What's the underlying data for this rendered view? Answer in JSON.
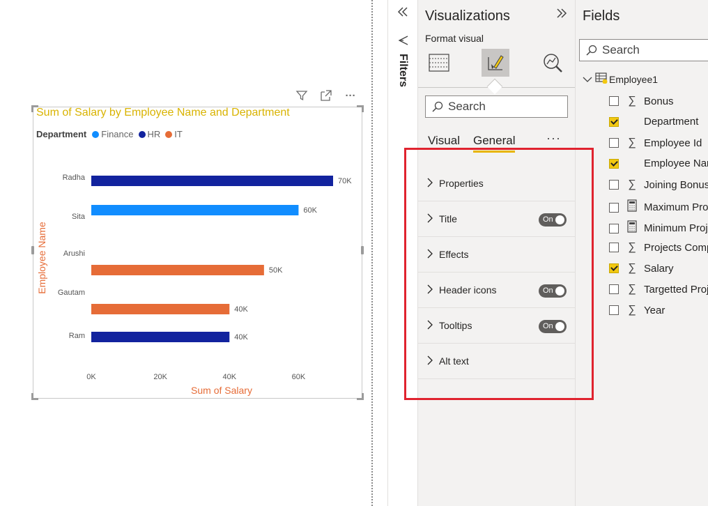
{
  "visual_header": {
    "filter_icon": "funnel-icon",
    "focus_icon": "focus-mode-icon",
    "more_icon": "more-options-icon",
    "more_label": "···"
  },
  "chart": {
    "title": "Sum of Salary by Employee Name and Department",
    "legend_title": "Department",
    "legend": [
      {
        "name": "Finance",
        "color": "#118dff"
      },
      {
        "name": "HR",
        "color": "#12239e"
      },
      {
        "name": "IT",
        "color": "#e66c37"
      }
    ]
  },
  "chart_data": {
    "type": "bar",
    "orientation": "horizontal",
    "title": "Sum of Salary by Employee Name and Department",
    "xlabel": "Sum of Salary",
    "ylabel": "Employee Name",
    "xlim": [
      0,
      70000
    ],
    "x_ticks": [
      "0K",
      "20K",
      "40K",
      "60K"
    ],
    "legend_title": "Department",
    "categories": [
      "Radha",
      "Sita",
      "Arushi",
      "Gautam",
      "Ram"
    ],
    "series": [
      {
        "name": "Finance",
        "color": "#118dff",
        "values": [
          null,
          60000,
          null,
          null,
          null
        ]
      },
      {
        "name": "HR",
        "color": "#12239e",
        "values": [
          70000,
          null,
          null,
          null,
          40000
        ]
      },
      {
        "name": "IT",
        "color": "#e66c37",
        "values": [
          null,
          null,
          50000,
          40000,
          null
        ]
      }
    ],
    "data_labels": [
      "70K",
      "60K",
      "50K",
      "40K",
      "40K"
    ],
    "grid": false,
    "legend_position": "top-left"
  },
  "filters": {
    "collapse_icon": "double-chevron-left-icon",
    "label": "Filters"
  },
  "visualizations": {
    "title": "Visualizations",
    "expand_icon": "double-chevron-right-icon",
    "format_label": "Format visual",
    "search_placeholder": "Search",
    "tabs": [
      {
        "label": "Visual",
        "active": false
      },
      {
        "label": "General",
        "active": true
      }
    ],
    "tabs_more": "···",
    "sections": [
      {
        "label": "Properties",
        "toggle": null
      },
      {
        "label": "Title",
        "toggle": "On"
      },
      {
        "label": "Effects",
        "toggle": null
      },
      {
        "label": "Header icons",
        "toggle": "On"
      },
      {
        "label": "Tooltips",
        "toggle": "On"
      },
      {
        "label": "Alt text",
        "toggle": null
      }
    ]
  },
  "fields": {
    "title": "Fields",
    "search_placeholder": "Search",
    "table_name": "Employee1",
    "items": [
      {
        "label": "Bonus",
        "checked": false,
        "icon": "sigma"
      },
      {
        "label": "Department",
        "checked": true,
        "icon": "none"
      },
      {
        "label": "Employee Id",
        "checked": false,
        "icon": "sigma"
      },
      {
        "label": "Employee Name",
        "checked": true,
        "icon": "none"
      },
      {
        "label": "Joining Bonus",
        "checked": false,
        "icon": "sigma"
      },
      {
        "label": "Maximum Projects",
        "checked": false,
        "icon": "calculator"
      },
      {
        "label": "Minimum Projects",
        "checked": false,
        "icon": "calculator"
      },
      {
        "label": "Projects Completed",
        "checked": false,
        "icon": "sigma"
      },
      {
        "label": "Salary",
        "checked": true,
        "icon": "sigma"
      },
      {
        "label": "Targetted Projects",
        "checked": false,
        "icon": "sigma"
      },
      {
        "label": "Year",
        "checked": false,
        "icon": "sigma"
      }
    ]
  },
  "colors": {
    "accent": "#f2c811",
    "highlight": "#e0232f",
    "title": "#d9b300",
    "axis_label": "#e66c37"
  }
}
